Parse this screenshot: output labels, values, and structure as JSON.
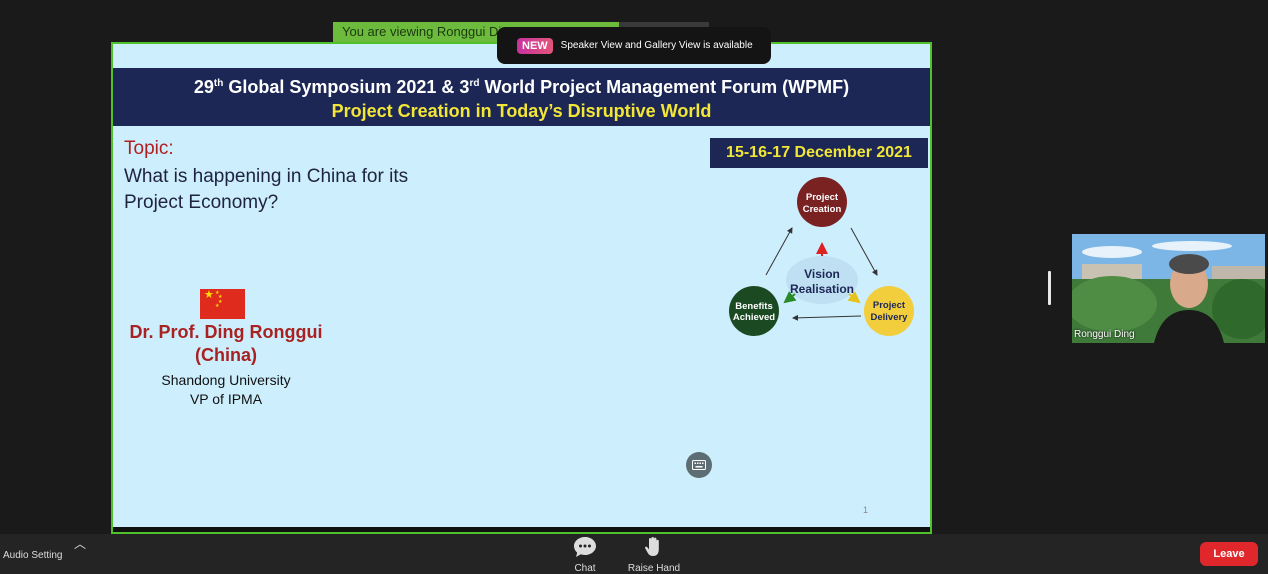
{
  "banner": {
    "viewing_text": "You are viewing Ronggui Ding's screen"
  },
  "toast": {
    "badge": "NEW",
    "text": "Speaker View and Gallery View is available"
  },
  "slide": {
    "header_line1_pre": "29",
    "header_line1_sup1": "th",
    "header_line1_mid": " Global Symposium 2021 & 3",
    "header_line1_sup2": "rd",
    "header_line1_post": " World Project Management Forum (WPMF)",
    "header_line2": "Project Creation in Today’s Disruptive World",
    "date": "15-16-17 December 2021",
    "topic_label": "Topic:",
    "topic_text": "What is happening in China for its Project Economy?",
    "speaker_name_line1": "Dr. Prof. Ding Ronggui",
    "speaker_name_line2": "(China)",
    "speaker_affiliation_line1": "Shandong University",
    "speaker_affiliation_line2": "VP of IPMA",
    "page_number": "1",
    "diagram": {
      "center_line1": "Vision",
      "center_line2": "Realisation",
      "top_line1": "Project",
      "top_line2": "Creation",
      "right_line1": "Project",
      "right_line2": "Delivery",
      "left_line1": "Benefits",
      "left_line2": "Achieved"
    }
  },
  "thumbnail": {
    "name": "Ronggui Ding"
  },
  "toolbar": {
    "audio_label": "Audio Setting",
    "chat_label": "Chat",
    "raise_hand_label": "Raise Hand",
    "leave_label": "Leave"
  },
  "colors": {
    "share_border": "#4fc12a",
    "slide_header_bg": "#1c2756",
    "leave_button": "#e0282c"
  }
}
